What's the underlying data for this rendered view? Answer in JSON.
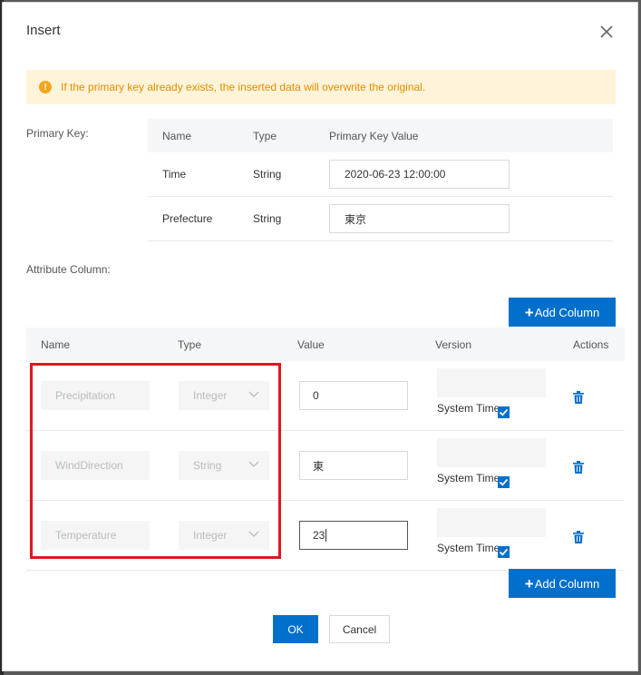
{
  "dialog": {
    "title": "Insert"
  },
  "alert": {
    "text": "If the primary key already exists, the inserted data will overwrite the original."
  },
  "primary_key": {
    "label": "Primary Key:",
    "headers": {
      "name": "Name",
      "type": "Type",
      "value": "Primary Key Value"
    },
    "rows": [
      {
        "name": "Time",
        "type": "String",
        "value": "2020-06-23 12:00:00"
      },
      {
        "name": "Prefecture",
        "type": "String",
        "value": "東京"
      }
    ]
  },
  "attribute": {
    "label": "Attribute Column:",
    "add_column_label": "Add Column",
    "headers": {
      "name": "Name",
      "type": "Type",
      "value": "Value",
      "version": "Version",
      "actions": "Actions"
    },
    "rows": [
      {
        "name": "Precipitation",
        "type": "Integer",
        "value": "0",
        "version_label": "System Time",
        "checked": true
      },
      {
        "name": "WindDirection",
        "type": "String",
        "value": "東",
        "version_label": "System Time",
        "checked": true
      },
      {
        "name": "Temperature",
        "type": "Integer",
        "value": "23",
        "version_label": "System Time",
        "checked": true
      }
    ]
  },
  "footer": {
    "ok_label": "OK",
    "cancel_label": "Cancel"
  },
  "colors": {
    "primary": "#0070cc",
    "warning_bg": "#fff4d9",
    "warning_text": "#e58d00",
    "highlight": "#e0161e"
  },
  "icons": {
    "close": "close-icon",
    "warning": "warning-icon",
    "chevron": "chevron-down-icon",
    "trash": "trash-icon",
    "check": "checkbox-checked-icon"
  }
}
